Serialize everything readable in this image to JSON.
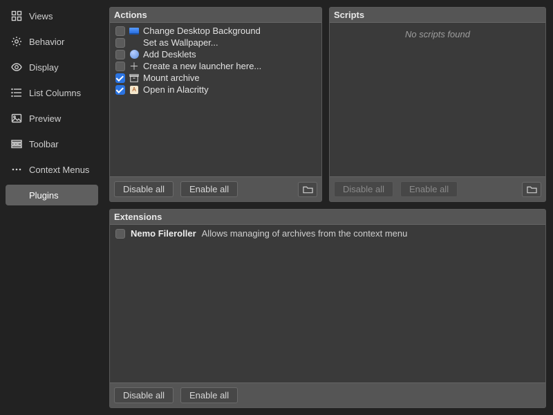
{
  "sidebar": {
    "items": [
      {
        "label": "Views"
      },
      {
        "label": "Behavior"
      },
      {
        "label": "Display"
      },
      {
        "label": "List Columns"
      },
      {
        "label": "Preview"
      },
      {
        "label": "Toolbar"
      },
      {
        "label": "Context Menus"
      },
      {
        "label": "Plugins"
      }
    ],
    "selected": "Plugins"
  },
  "actions_panel": {
    "title": "Actions",
    "items": [
      {
        "checked": false,
        "label": "Change Desktop Background"
      },
      {
        "checked": false,
        "label": "Set as Wallpaper..."
      },
      {
        "checked": false,
        "label": "Add Desklets"
      },
      {
        "checked": false,
        "label": "Create a new launcher here..."
      },
      {
        "checked": true,
        "label": "Mount archive"
      },
      {
        "checked": true,
        "label": "Open in Alacritty"
      }
    ],
    "disable_all": "Disable all",
    "enable_all": "Enable all"
  },
  "scripts_panel": {
    "title": "Scripts",
    "empty_text": "No scripts found",
    "disable_all": "Disable all",
    "enable_all": "Enable all"
  },
  "extensions_panel": {
    "title": "Extensions",
    "items": [
      {
        "checked": false,
        "name": "Nemo Fileroller",
        "desc": "Allows managing of archives from the context menu"
      }
    ],
    "disable_all": "Disable all",
    "enable_all": "Enable all"
  }
}
